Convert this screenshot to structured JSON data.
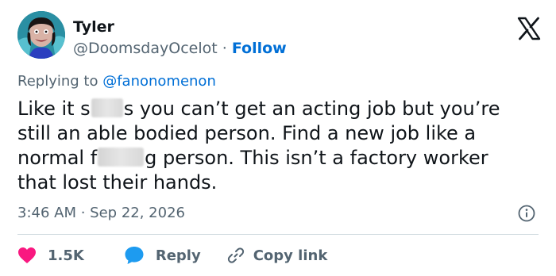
{
  "author": {
    "name": "Tyler",
    "handle": "@DoomsdayOcelot",
    "separator": " · ",
    "follow_label": "Follow"
  },
  "reply_context": {
    "prefix": "Replying to ",
    "mention": "@fanonomenon"
  },
  "tweet": {
    "line1_a": "Like it s",
    "line1_b": "s you can’t get an acting job but you’re",
    "line2": "still an able bodied person. Find a new job like a",
    "line3_a": "normal f",
    "line3_b": "g person. This isn’t a factory worker",
    "line4": "that lost their hands."
  },
  "meta": {
    "time": "3:46 AM",
    "dot": " · ",
    "date": "Sep 22, 2026"
  },
  "actions": {
    "like_count": "1.5K",
    "reply_label": "Reply",
    "copy_label": "Copy link"
  },
  "colors": {
    "link_blue": "#006fd6",
    "like_red": "#f91880",
    "reply_blue": "#1d9bf0",
    "muted_text": "#536471",
    "divider": "#cfd9de"
  },
  "icons": {
    "brand": "x-logo-icon",
    "info": "info-icon",
    "like": "heart-icon",
    "reply": "speech-bubble-icon",
    "copy": "link-icon"
  }
}
